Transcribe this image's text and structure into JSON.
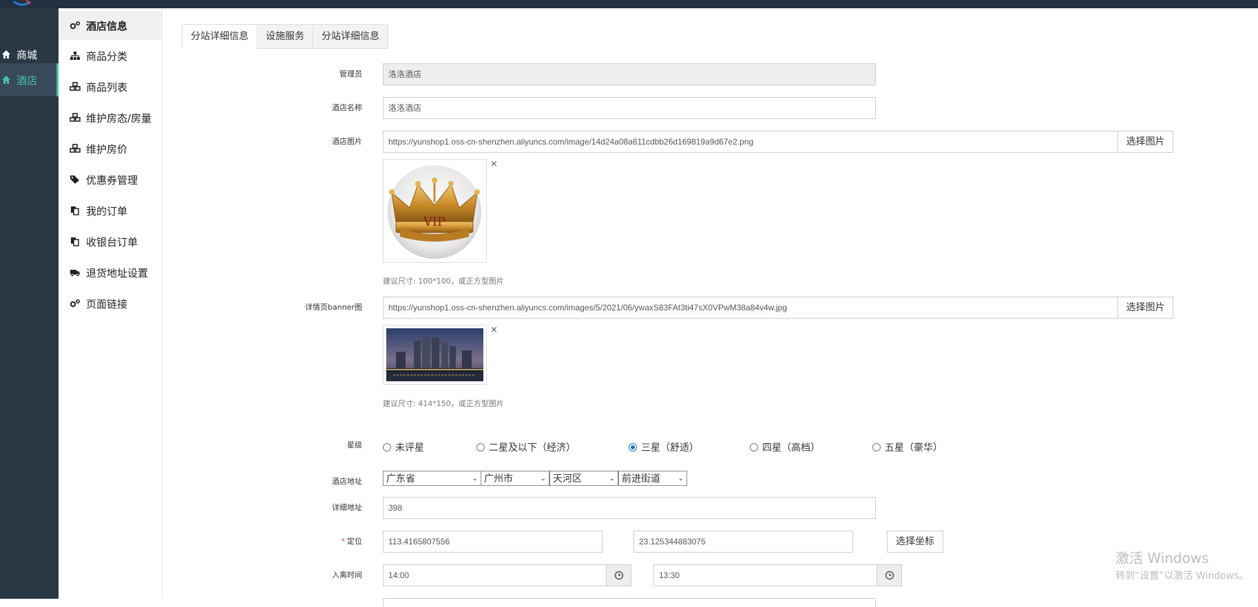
{
  "nav1": {
    "items": [
      {
        "label": "商城",
        "icon": "home-icon"
      },
      {
        "label": "酒店",
        "icon": "home-icon"
      }
    ]
  },
  "nav2": {
    "items": [
      {
        "label": "酒店信息",
        "icon": "gears-icon"
      },
      {
        "label": "商品分类",
        "icon": "sitemap-icon"
      },
      {
        "label": "商品列表",
        "icon": "cubes-icon"
      },
      {
        "label": "维护房态/房量",
        "icon": "cubes-icon"
      },
      {
        "label": "维护房价",
        "icon": "cubes-icon"
      },
      {
        "label": "优惠券管理",
        "icon": "tags-icon"
      },
      {
        "label": "我的订单",
        "icon": "copy-icon"
      },
      {
        "label": "收银台订单",
        "icon": "copy-icon"
      },
      {
        "label": "退货地址设置",
        "icon": "truck-icon"
      },
      {
        "label": "页面链接",
        "icon": "gears-icon"
      }
    ]
  },
  "tabs": [
    "分站详细信息",
    "设施服务",
    "分站详细信息"
  ],
  "form": {
    "admin": {
      "label": "管理员",
      "value": "洛洛酒店"
    },
    "hotel_name": {
      "label": "酒店名称",
      "value": "洛洛酒店"
    },
    "hotel_image": {
      "label": "酒店图片",
      "value": "https://yunshop1.oss-cn-shenzhen.aliyuncs.com/image/14d24a08a611cdbb26d169819a9d67e2.png",
      "button": "选择图片",
      "thumb_text": "VIP",
      "close": "×",
      "hint": "建议尺寸: 100*100，或正方型图片"
    },
    "banner": {
      "label": "详情页banner图",
      "value": "https://yunshop1.oss-cn-shenzhen.aliyuncs.com/images/5/2021/06/ywaxS83FAt3ti47sX0VPwM38a84v4w.jpg",
      "button": "选择图片",
      "close": "×",
      "hint": "建议尺寸: 414*150，或正方型图片"
    },
    "star": {
      "label": "星级",
      "options": [
        "未评星",
        "二星及以下（经济）",
        "三星（舒适）",
        "四星（高档）",
        "五星（豪华）"
      ],
      "selected_index": 2
    },
    "address": {
      "label": "酒店地址",
      "province": "广东省",
      "city": "广州市",
      "district": "天河区",
      "street": "前进街道"
    },
    "detail_address": {
      "label": "详细地址",
      "value": "398"
    },
    "location": {
      "required_mark": "*",
      "label": "定位",
      "lng": "113.4165807556",
      "lat": "23.125344883075",
      "button": "选择坐标"
    },
    "checkin": {
      "label": "入离时间",
      "start": "14:00",
      "end": "13:30"
    }
  },
  "watermark": {
    "line1": "激活 Windows",
    "line2": "转到“设置”以激活 Windows。"
  },
  "colors": {
    "sidebar_dark": "#2a3845",
    "accent": "#44c2a7",
    "radio_checked": "#1d6fd6"
  }
}
